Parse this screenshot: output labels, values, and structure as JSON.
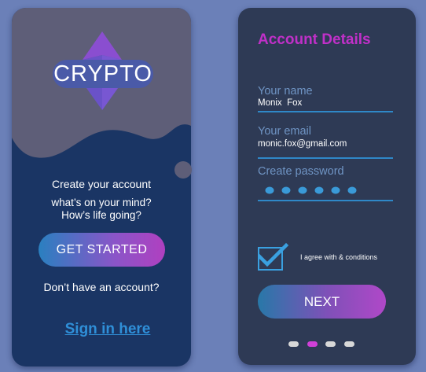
{
  "welcome_screen": {
    "brand_name": "CRYPTO",
    "heading": "Create your account",
    "tagline_line1": "what’s on your mind?",
    "tagline_line2": "How’s life going?",
    "get_started_label": "GET STARTED",
    "no_account_text": "Don’t have an account?",
    "sign_in_link": "Sign in here"
  },
  "account_screen": {
    "title": "Account Details",
    "name_label": "Your name",
    "name_value": "Monix  Fox",
    "email_label": "Your email",
    "email_value": "monic.fox@gmail.com",
    "password_label": "Create password",
    "password_dot_count": 6,
    "terms_checked": true,
    "terms_text": "I agree with & conditions",
    "next_label": "NEXT",
    "pager": {
      "count": 4,
      "active_index": 1
    }
  },
  "colors": {
    "page_background": "#6b80b8",
    "accent_purple": "#c030c8",
    "accent_blue": "#2f88c8",
    "field_label": "#6f94c4",
    "left_panel": "#1a3564",
    "right_panel": "#2e3a55",
    "active_page_dot": "#d040d8"
  },
  "icons": {
    "logo": "diamond-crystal",
    "checkbox": "check-mark"
  }
}
